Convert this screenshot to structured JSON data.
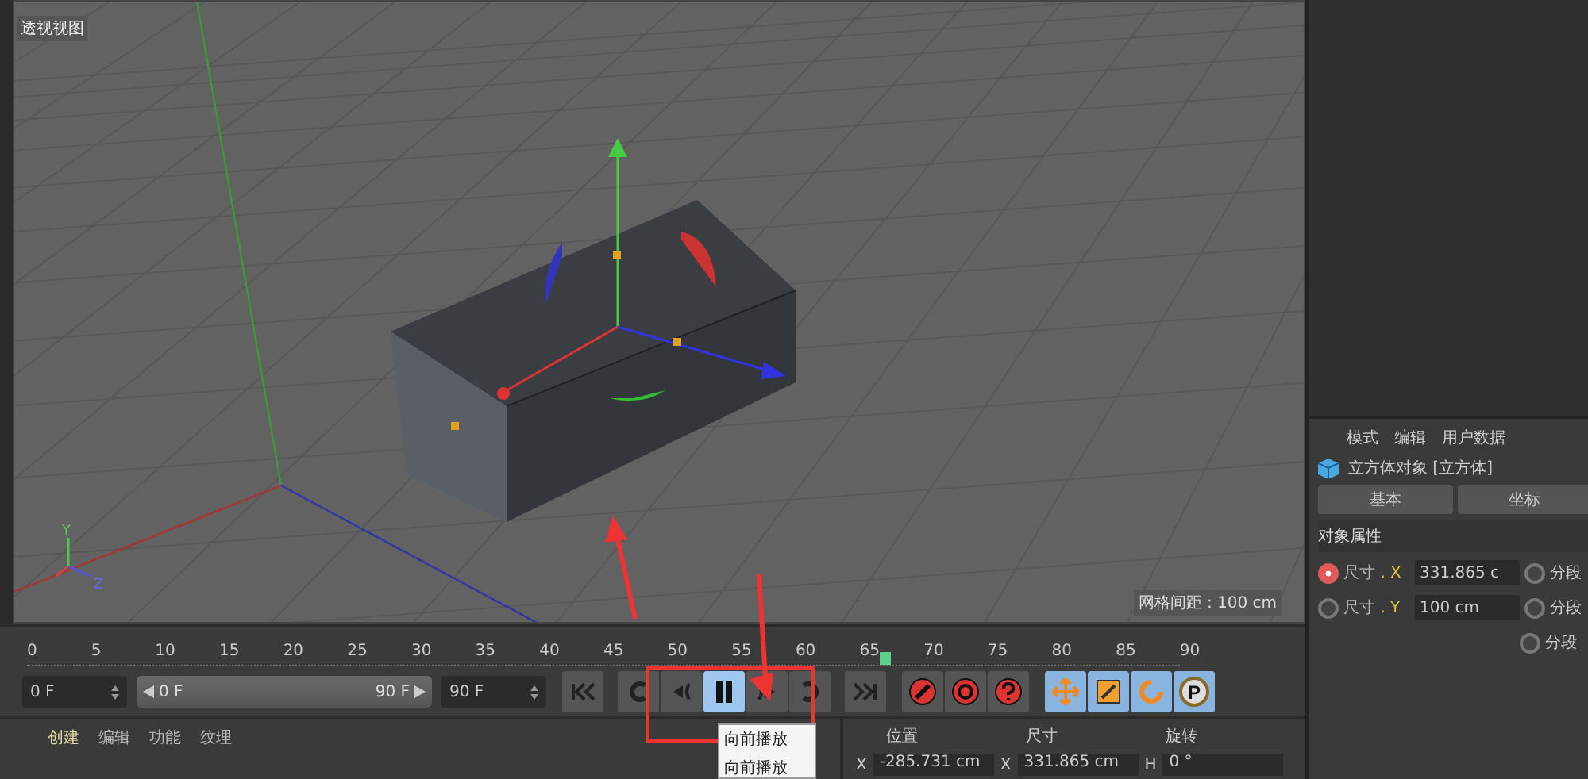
{
  "viewport": {
    "label": "透视视图",
    "grid_spacing": "网格间距 : 100 cm",
    "axis_labels": [
      "Y",
      "Z"
    ]
  },
  "attributes": {
    "menu": [
      "模式",
      "编辑",
      "用户数据"
    ],
    "object_title": "立方体对象 [立方体]",
    "tabs": [
      {
        "label": "基本",
        "selected": false
      },
      {
        "label": "坐标",
        "selected": false
      }
    ],
    "section": "对象属性",
    "rows": [
      {
        "label": "尺寸",
        "axis": ". X",
        "value": "331.865 c",
        "keyframe": true,
        "side_label": "分段"
      },
      {
        "label": "尺寸",
        "axis": ". Y",
        "value": "100 cm",
        "keyframe": false,
        "side_label": "分段"
      },
      {
        "side_label": "分段"
      }
    ]
  },
  "timeline": {
    "ticks": [
      "0",
      "5",
      "10",
      "15",
      "20",
      "25",
      "30",
      "35",
      "40",
      "45",
      "50",
      "55",
      "60",
      "65",
      "70",
      "75",
      "80",
      "85",
      "90"
    ],
    "playhead": {
      "level": 0.744
    }
  },
  "transport": {
    "start_field": "0 F",
    "range": {
      "start": "0 F",
      "end": "90 F",
      "level": 1
    },
    "end_field": "90 F",
    "playback_buttons": [
      {
        "kind": "to-start",
        "selected": false
      },
      {
        "kind": "prev-key",
        "selected": false
      },
      {
        "kind": "play-back",
        "selected": false
      },
      {
        "kind": "pause",
        "selected": true
      },
      {
        "kind": "play-forward",
        "selected": false
      },
      {
        "kind": "next-key",
        "selected": false
      },
      {
        "kind": "to-end",
        "selected": false
      }
    ],
    "record_buttons": [
      {
        "kind": "record"
      },
      {
        "kind": "auto-key"
      },
      {
        "kind": "help"
      }
    ],
    "mode_buttons": [
      {
        "kind": "move"
      },
      {
        "kind": "scale"
      },
      {
        "kind": "rotate"
      },
      {
        "kind": "param",
        "label": "P"
      }
    ]
  },
  "tooltip": [
    "向前播放",
    "向前播放"
  ],
  "materials_menu": [
    {
      "label": "创建",
      "selected": true
    },
    {
      "label": "编辑",
      "selected": false
    },
    {
      "label": "功能",
      "selected": false
    },
    {
      "label": "纹理",
      "selected": false
    }
  ],
  "coordinates": {
    "headers": [
      "位置",
      "尺寸",
      "旋转"
    ],
    "fields": [
      {
        "axis": "X",
        "value": "-285.731 cm"
      },
      {
        "axis": "X",
        "value": "331.865 cm"
      },
      {
        "axis": "H",
        "value": "0 °"
      }
    ]
  }
}
